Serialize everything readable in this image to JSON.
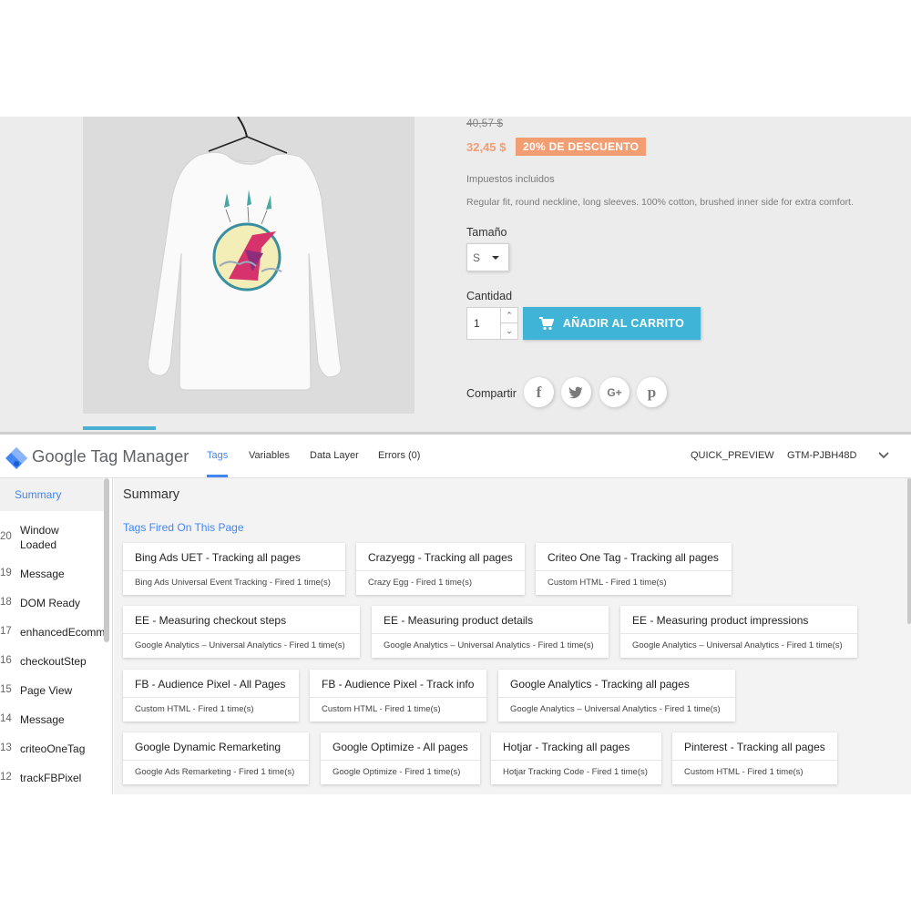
{
  "product": {
    "old_price": "40,57 $",
    "new_price": "32,45 $",
    "discount": "20% DE DESCUENTO",
    "tax_note": "Impuestos incluidos",
    "description": "Regular fit, round neckline, long sleeves. 100% cotton, brushed inner side for extra comfort.",
    "size_label": "Tamaño",
    "size_value": "S",
    "quantity_label": "Cantidad",
    "quantity_value": "1",
    "add_to_cart_label": "AÑADIR AL CARRITO",
    "share_label": "Compartir",
    "share_buttons": [
      "facebook-icon",
      "twitter-icon",
      "google-plus-icon",
      "pinterest-icon"
    ],
    "accent_color": "#3fb4d6",
    "discount_color": "#f39d72"
  },
  "gtm": {
    "brand": "Google Tag Manager",
    "tabs": [
      "Tags",
      "Variables",
      "Data Layer",
      "Errors (0)"
    ],
    "active_tab": "Tags",
    "preview_mode": "QUICK_PREVIEW",
    "container_id": "GTM-PJBH48D",
    "sidebar": {
      "summary_label": "Summary",
      "events": [
        {
          "num": "20",
          "name": "Window Loaded"
        },
        {
          "num": "19",
          "name": "Message"
        },
        {
          "num": "18",
          "name": "DOM Ready"
        },
        {
          "num": "17",
          "name": "enhancedEcomm"
        },
        {
          "num": "16",
          "name": "checkoutStep"
        },
        {
          "num": "15",
          "name": "Page View"
        },
        {
          "num": "14",
          "name": "Message"
        },
        {
          "num": "13",
          "name": "criteoOneTag"
        },
        {
          "num": "12",
          "name": "trackFBPixel"
        }
      ]
    },
    "main": {
      "title": "Summary",
      "section_title": "Tags Fired On This Page",
      "tags": [
        {
          "name": "Bing Ads UET - Tracking all pages",
          "detail": "Bing Ads Universal Event Tracking - Fired 1 time(s)"
        },
        {
          "name": "Crazyegg - Tracking all pages",
          "detail": "Crazy Egg - Fired 1 time(s)"
        },
        {
          "name": "Criteo One Tag - Tracking all pages",
          "detail": "Custom HTML - Fired 1 time(s)"
        },
        {
          "name": "EE - Measuring checkout steps",
          "detail": "Google Analytics – Universal Analytics - Fired 1 time(s)"
        },
        {
          "name": "EE - Measuring product details",
          "detail": "Google Analytics – Universal Analytics - Fired 1 time(s)"
        },
        {
          "name": "EE - Measuring product impressions",
          "detail": "Google Analytics – Universal Analytics - Fired 1 time(s)"
        },
        {
          "name": "FB - Audience Pixel - All Pages",
          "detail": "Custom HTML - Fired 1 time(s)"
        },
        {
          "name": "FB - Audience Pixel - Track info",
          "detail": "Custom HTML - Fired 1 time(s)"
        },
        {
          "name": "Google Analytics - Tracking all pages",
          "detail": "Google Analytics – Universal Analytics - Fired 1 time(s)"
        },
        {
          "name": "Google Dynamic Remarketing",
          "detail": "Google Ads Remarketing - Fired 1 time(s)"
        },
        {
          "name": "Google Optimize - All pages",
          "detail": "Google Optimize - Fired 1 time(s)"
        },
        {
          "name": "Hotjar - Tracking all pages",
          "detail": "Hotjar Tracking Code - Fired 1 time(s)"
        },
        {
          "name": "Pinterest - Tracking all pages",
          "detail": "Custom HTML - Fired 1 time(s)"
        }
      ]
    },
    "accent_color": "#4285f4"
  }
}
